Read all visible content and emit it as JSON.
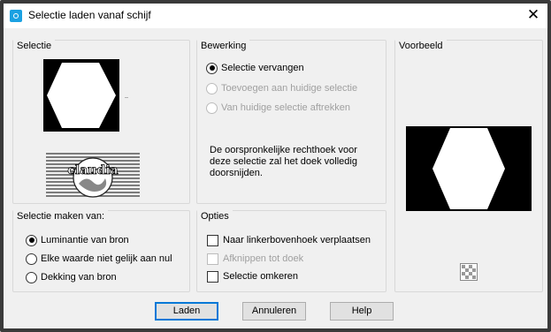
{
  "window": {
    "title": "Selectie laden vanaf schijf",
    "close_label": "✕"
  },
  "selectie": {
    "title": "Selectie",
    "logo_text": "claudia"
  },
  "bewerking": {
    "title": "Bewerking",
    "options": [
      {
        "label": "Selectie vervangen",
        "checked": true,
        "enabled": true
      },
      {
        "label": "Toevoegen aan huidige selectie",
        "checked": false,
        "enabled": false
      },
      {
        "label": "Van huidige selectie aftrekken",
        "checked": false,
        "enabled": false
      }
    ],
    "note": "De oorspronkelijke rechthoek voor deze selectie zal het doek volledig doorsnijden."
  },
  "voorbeeld": {
    "title": "Voorbeeld"
  },
  "maken_van": {
    "title": "Selectie maken van:",
    "options": [
      {
        "label": "Luminantie van bron",
        "checked": true
      },
      {
        "label": "Elke waarde niet gelijk aan nul",
        "checked": false
      },
      {
        "label": "Dekking van bron",
        "checked": false
      }
    ]
  },
  "opties": {
    "title": "Opties",
    "options": [
      {
        "label": "Naar linkerbovenhoek verplaatsen",
        "checked": false,
        "enabled": true
      },
      {
        "label": "Afknippen tot doek",
        "checked": false,
        "enabled": false
      },
      {
        "label": "Selectie omkeren",
        "checked": false,
        "enabled": true
      }
    ]
  },
  "buttons": {
    "load": "Laden",
    "cancel": "Annuleren",
    "help": "Help"
  },
  "colors": {
    "default_button_border": "#0078d7",
    "app_icon": "#1ba1e2"
  },
  "icons": {
    "app": "paint-app-icon",
    "close": "close-icon",
    "preview_toggle": "checkerboard-icon"
  }
}
